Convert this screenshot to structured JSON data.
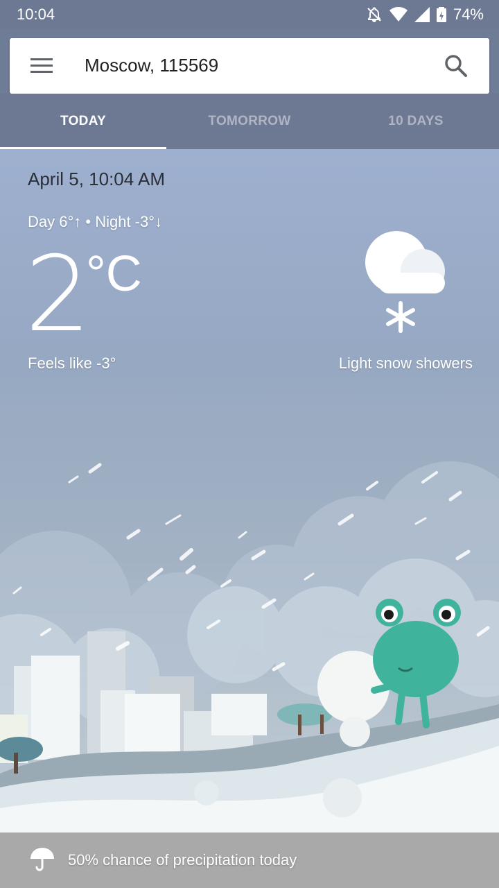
{
  "status_bar": {
    "time": "10:04",
    "battery": "74%",
    "icons": [
      "bell-off-icon",
      "wifi-icon",
      "signal-icon",
      "battery-icon"
    ]
  },
  "search": {
    "location": "Moscow, 115569",
    "icons": [
      "menu-icon",
      "search-icon"
    ]
  },
  "tabs": [
    {
      "label": "TODAY",
      "active": true
    },
    {
      "label": "TOMORROW",
      "active": false
    },
    {
      "label": "10 DAYS",
      "active": false
    }
  ],
  "current": {
    "datetime": "April 5, 10:04 AM",
    "day_night": "Day 6°↑ • Night -3°↓",
    "temperature": "2",
    "unit": "°C",
    "feels_like": "Feels like -3°",
    "condition": "Light snow showers",
    "condition_icon": "snow-cloud-icon"
  },
  "footer": {
    "precipitation": "50% chance of precipitation today",
    "icon": "umbrella-icon"
  },
  "colors": {
    "status_bar": "#6d7893",
    "sky_top": "#9eb0cf",
    "footer": "#a9a9a9",
    "frog": "#3fb39b"
  }
}
